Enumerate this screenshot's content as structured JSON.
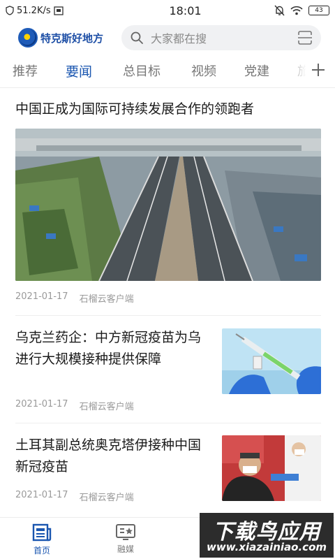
{
  "status_bar": {
    "speed": "51.2K/s",
    "time": "18:01",
    "battery": "43"
  },
  "header": {
    "app_name": "特克斯好地方",
    "search_placeholder": "大家都在搜"
  },
  "tabs": [
    {
      "label": "推荐",
      "active": false
    },
    {
      "label": "要闻",
      "active": true
    },
    {
      "label": "总目标",
      "active": false
    },
    {
      "label": "视频",
      "active": false
    },
    {
      "label": "党建",
      "active": false
    },
    {
      "label": "旅",
      "active": false
    }
  ],
  "articles": [
    {
      "title": "中国正成为国际可持续发展合作的领跑者",
      "date": "2021-01-17",
      "source": "石榴云客户端"
    },
    {
      "title": "乌克兰药企：中方新冠疫苗为乌进行大规模接种提供保障",
      "date": "2021-01-17",
      "source": "石榴云客户端"
    },
    {
      "title": "土耳其副总统奥克塔伊接种中国新冠疫苗",
      "date": "2021-01-17",
      "source": "石榴云客户端"
    }
  ],
  "bottom_nav": [
    {
      "label": "首页",
      "icon": "home-news-icon",
      "active": true
    },
    {
      "label": "融媒",
      "icon": "media-star-icon",
      "active": false
    }
  ],
  "watermark": {
    "main": "下载鸟应用",
    "sub": "www.xiazainiao.com"
  },
  "colors": {
    "accent": "#1a56b0",
    "text": "#1a1a1a",
    "meta": "#9a9a9a"
  }
}
